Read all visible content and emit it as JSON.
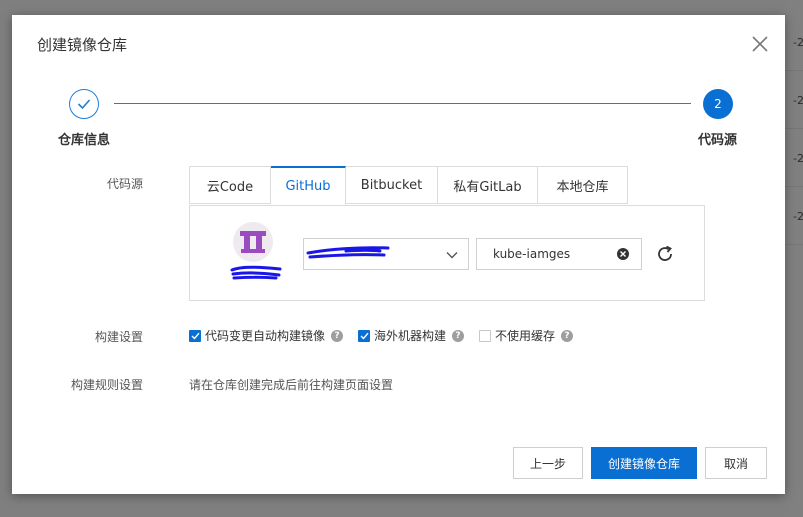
{
  "dialog": {
    "title": "创建镜像仓库"
  },
  "steps": [
    {
      "index": "1",
      "label": "仓库信息",
      "status": "done"
    },
    {
      "index": "2",
      "label": "代码源",
      "status": "current"
    }
  ],
  "form": {
    "source_label": "代码源",
    "build_settings_label": "构建设置",
    "build_rules_label": "构建规则设置",
    "build_rules_text": "请在仓库创建完成后前往构建页面设置"
  },
  "tabs": [
    {
      "label": "云Code",
      "active": false
    },
    {
      "label": "GitHub",
      "active": true
    },
    {
      "label": "Bitbucket",
      "active": false
    },
    {
      "label": "私有GitLab",
      "active": false
    },
    {
      "label": "本地仓库",
      "active": false
    }
  ],
  "source": {
    "repo_name": "kube-iamges"
  },
  "build_options": [
    {
      "label": "代码变更自动构建镜像",
      "checked": true
    },
    {
      "label": "海外机器构建",
      "checked": true
    },
    {
      "label": "不使用缓存",
      "checked": false
    }
  ],
  "footer": {
    "prev_label": "上一步",
    "create_label": "创建镜像仓库",
    "cancel_label": "取消"
  },
  "background": {
    "peek": [
      "-2",
      "-2",
      "-2",
      "-2"
    ]
  },
  "colors": {
    "primary": "#0a6fd2",
    "overlay": "#7f7f7f",
    "scribble": "#1a16e8"
  }
}
